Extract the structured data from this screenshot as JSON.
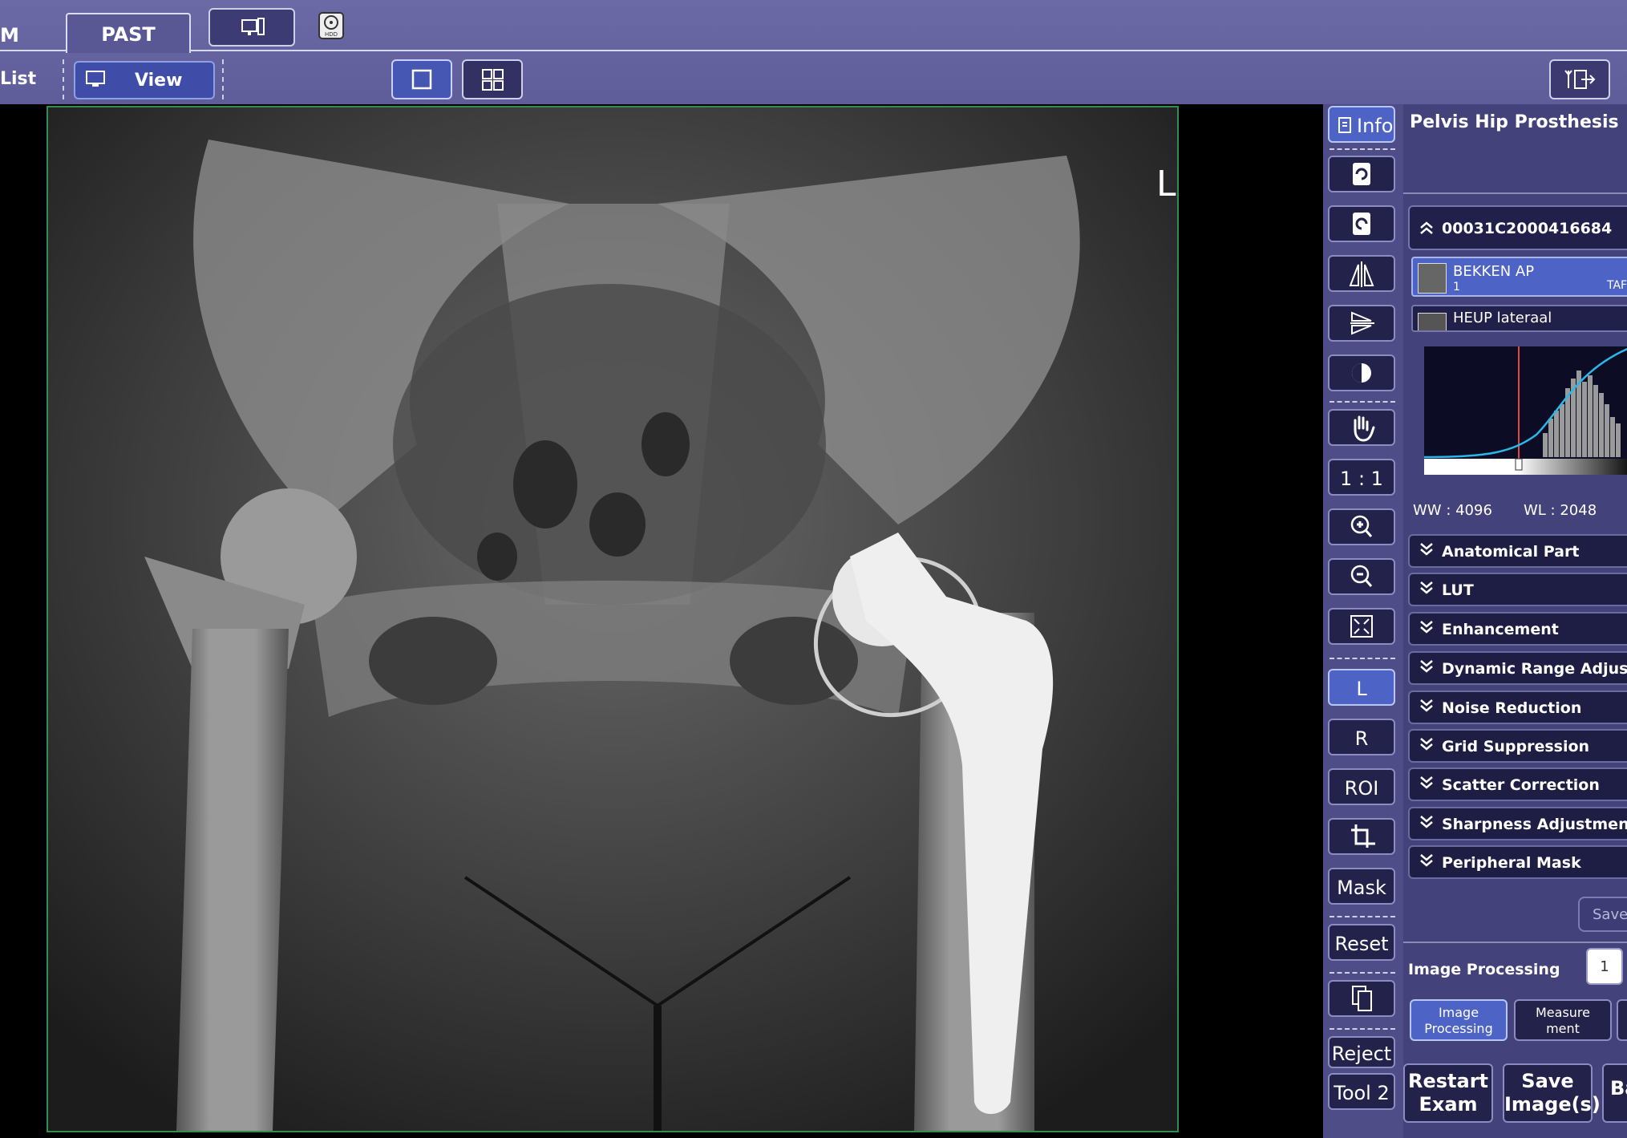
{
  "tabs": {
    "m_label": "M",
    "past_label": "PAST"
  },
  "toolbar": {
    "list_label": "List",
    "view_label": "View"
  },
  "viewer": {
    "orientation_marker": "L"
  },
  "tools": {
    "info": "Info",
    "one_to_one": "1 : 1",
    "left_marker": "L",
    "right_marker": "R",
    "roi": "ROI",
    "mask": "Mask",
    "reset": "Reset",
    "reject": "Reject",
    "tool2": "Tool 2"
  },
  "panel": {
    "title": "Pelvis Hip Prosthesis",
    "accession": "00031C2000416684",
    "series": [
      {
        "name": "BEKKEN AP",
        "index": "1",
        "extra": "TAF"
      },
      {
        "name": "HEUP lateraal"
      }
    ],
    "ww": "WW : 4096",
    "wl": "WL : 2048",
    "sections": [
      "Anatomical Part",
      "LUT",
      "Enhancement",
      "Dynamic Range Adjustment",
      "Noise Reduction",
      "Grid Suppression",
      "Scatter Correction",
      "Sharpness Adjustment",
      "Peripheral Mask"
    ],
    "save_label": "Save",
    "image_processing_label": "Image Processing",
    "image_processing_value": "1",
    "modes": [
      {
        "line1": "Image",
        "line2": "Processing"
      },
      {
        "line1": "Measure",
        "line2": "ment"
      }
    ],
    "actions": [
      {
        "line1": "Restart",
        "line2": "Exam"
      },
      {
        "line1": "Save",
        "line2": "Image(s)"
      },
      {
        "line1": "Ba"
      }
    ]
  },
  "colors": {
    "accent_blue": "#4d63c6",
    "frame_green": "#2f8f4c",
    "toolbar_purple": "#6c6aa6"
  }
}
